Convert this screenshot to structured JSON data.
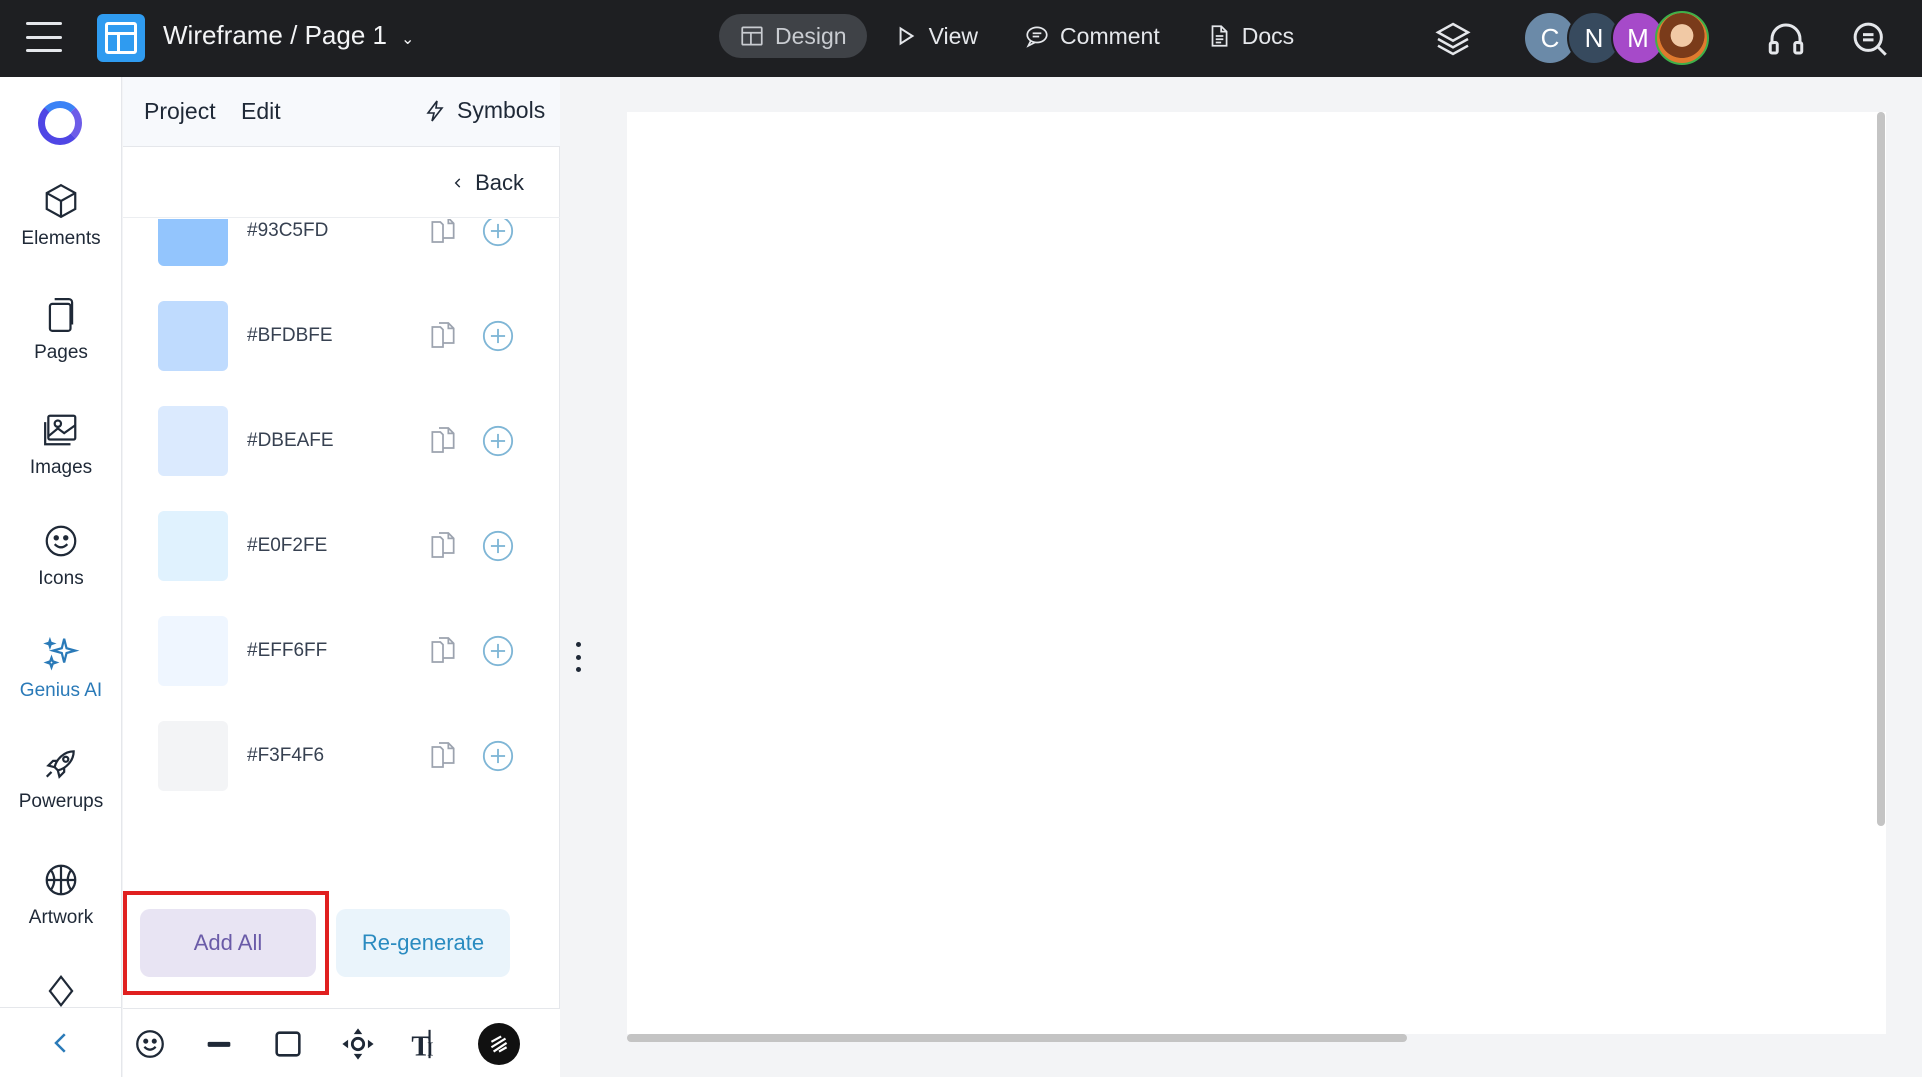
{
  "header": {
    "title": "Wireframe / Page 1",
    "tabs": [
      {
        "label": "Design",
        "active": true,
        "icon": "layout-icon"
      },
      {
        "label": "View",
        "icon": "play-icon"
      },
      {
        "label": "Comment",
        "icon": "comment-icon"
      },
      {
        "label": "Docs",
        "icon": "document-icon"
      }
    ],
    "avatars": [
      {
        "initial": "C",
        "color": "#6b8aa8"
      },
      {
        "initial": "N",
        "color": "#374a5e"
      },
      {
        "initial": "M",
        "color": "#a64ac9"
      },
      {
        "initial": "",
        "color": "#e07a2e",
        "photo": true
      }
    ]
  },
  "rail": {
    "items": [
      {
        "label": "Elements",
        "icon": "cube-icon"
      },
      {
        "label": "Pages",
        "icon": "pages-icon"
      },
      {
        "label": "Images",
        "icon": "image-icon"
      },
      {
        "label": "Icons",
        "icon": "smiley-icon"
      },
      {
        "label": "Genius AI",
        "icon": "sparkle-icon",
        "active": true
      },
      {
        "label": "Powerups",
        "icon": "rocket-icon"
      },
      {
        "label": "Artwork",
        "icon": "basketball-icon"
      }
    ]
  },
  "panel": {
    "menu": {
      "project": "Project",
      "edit": "Edit",
      "symbols": "Symbols"
    },
    "back": "Back",
    "swatches": [
      {
        "hex": "#93C5FD",
        "color": "#93c5fd"
      },
      {
        "hex": "#BFDBFE",
        "color": "#bfdbfe"
      },
      {
        "hex": "#DBEAFE",
        "color": "#dbeafe"
      },
      {
        "hex": "#E0F2FE",
        "color": "#e0f2fe"
      },
      {
        "hex": "#EFF6FF",
        "color": "#eff6ff"
      },
      {
        "hex": "#F3F4F6",
        "color": "#f3f4f6"
      }
    ],
    "add_all": "Add All",
    "regenerate": "Re-generate"
  },
  "toolbar": {
    "tools": [
      "smiley-icon",
      "line-icon",
      "rectangle-icon",
      "move-icon",
      "text-icon",
      "scribble-icon"
    ]
  },
  "colors": {
    "topbar": "#1e1f22",
    "accent": "#2a7ab8",
    "highlight": "#e02020"
  }
}
